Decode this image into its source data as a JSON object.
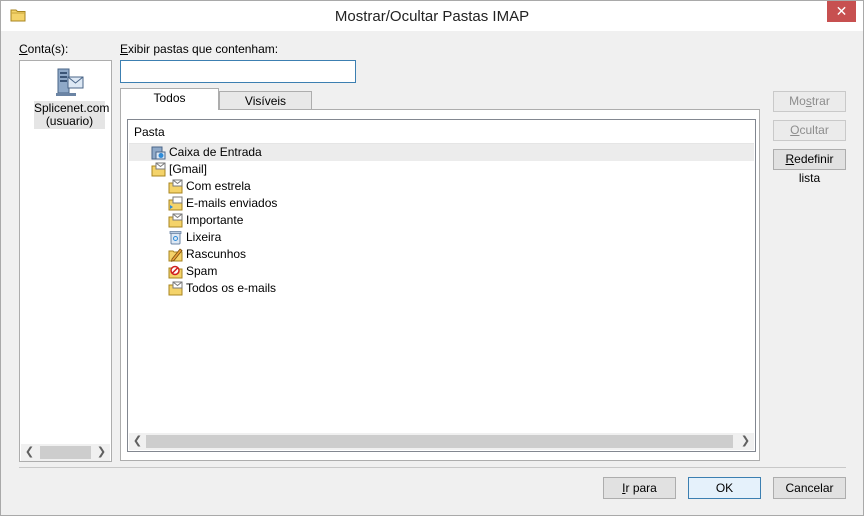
{
  "window": {
    "title": "Mostrar/Ocultar Pastas IMAP",
    "close_label": "✕"
  },
  "accounts": {
    "label_prefix": "C",
    "label_rest": "onta(s):",
    "items": [
      {
        "name_line1": "Splicenet.com",
        "name_line2": "(usuario)",
        "icon": "server-icon"
      }
    ]
  },
  "filter": {
    "label_prefix": "E",
    "label_rest": "xibir pastas que contenham:",
    "value": "",
    "placeholder": ""
  },
  "tabs": [
    {
      "label": "Todos",
      "active": true
    },
    {
      "label": "Visíveis",
      "active": false
    }
  ],
  "tree": {
    "header": "Pasta",
    "rows": [
      {
        "label": "Caixa de Entrada",
        "icon": "inbox-icon",
        "level": 1,
        "selected": true
      },
      {
        "label": "[Gmail]",
        "icon": "folder-mail-icon",
        "level": 1,
        "selected": false
      },
      {
        "label": "Com estrela",
        "icon": "folder-mail-icon",
        "level": 2,
        "selected": false
      },
      {
        "label": "E-mails enviados",
        "icon": "sent-icon",
        "level": 2,
        "selected": false
      },
      {
        "label": "Importante",
        "icon": "folder-mail-icon",
        "level": 2,
        "selected": false
      },
      {
        "label": "Lixeira",
        "icon": "trash-icon",
        "level": 2,
        "selected": false
      },
      {
        "label": "Rascunhos",
        "icon": "drafts-icon",
        "level": 2,
        "selected": false
      },
      {
        "label": "Spam",
        "icon": "spam-icon",
        "level": 2,
        "selected": false
      },
      {
        "label": "Todos os e-mails",
        "icon": "folder-mail-icon",
        "level": 2,
        "selected": false
      }
    ]
  },
  "side_buttons": {
    "show": {
      "prefix": "Mo",
      "u": "s",
      "rest": "trar",
      "enabled": false
    },
    "hide": {
      "prefix": "",
      "u": "O",
      "rest": "cultar",
      "enabled": false
    },
    "reset": {
      "prefix": "",
      "u": "R",
      "rest": "edefinir lista",
      "enabled": true
    }
  },
  "footer": {
    "goto": {
      "u": "I",
      "rest": "r para"
    },
    "ok": "OK",
    "cancel": "Cancelar"
  },
  "colors": {
    "accent": "#3c7fb1",
    "close": "#c75050",
    "selection": "#ececec",
    "folder": "#f4d36a"
  }
}
